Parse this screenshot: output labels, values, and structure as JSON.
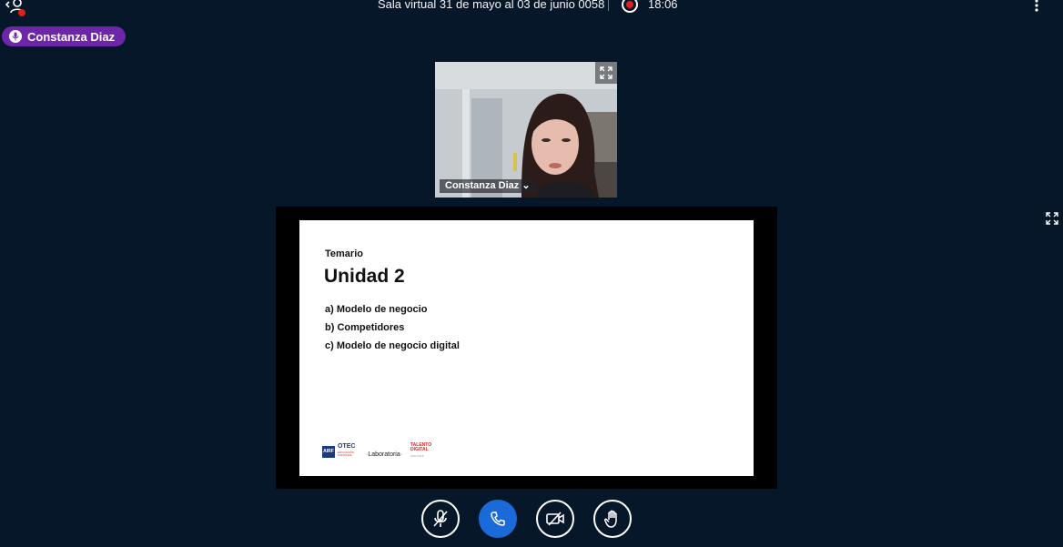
{
  "header": {
    "room_title": "Sala virtual 31 de mayo al 03 de junio 0058",
    "recording_time": "18:06"
  },
  "talking_indicator": {
    "name": "Constanza Diaz"
  },
  "webcam": {
    "user_name": "Constanza Diaz",
    "dropdown_glyph": "⌄"
  },
  "slide": {
    "kicker": "Temario",
    "heading": "Unidad 2",
    "items": [
      "a) Modelo de negocio",
      "b) Competidores",
      "c) Modelo de negocio digital"
    ],
    "logos": {
      "airf": "AIRF",
      "otec": "OTEC",
      "otec_sub": "EDUCACIÓN CONTINUA",
      "laboratoria": "·Laboratoria·",
      "talento": "TALENTO DIGITAL",
      "talento_sub": "PARA CHILE"
    }
  },
  "colors": {
    "background": "#06172a",
    "talker_badge": "#6d26a8",
    "recording": "#e0201b",
    "phone_button": "#1b6ad9"
  },
  "icons": {
    "user_list": "user-list-icon",
    "record": "record-icon",
    "options": "more-vertical-icon",
    "mic": "microphone-icon",
    "expand": "fullscreen-icon",
    "mute": "microphone-muted-icon",
    "phone": "phone-icon",
    "camera_off": "camera-off-icon",
    "hand": "raise-hand-icon"
  }
}
